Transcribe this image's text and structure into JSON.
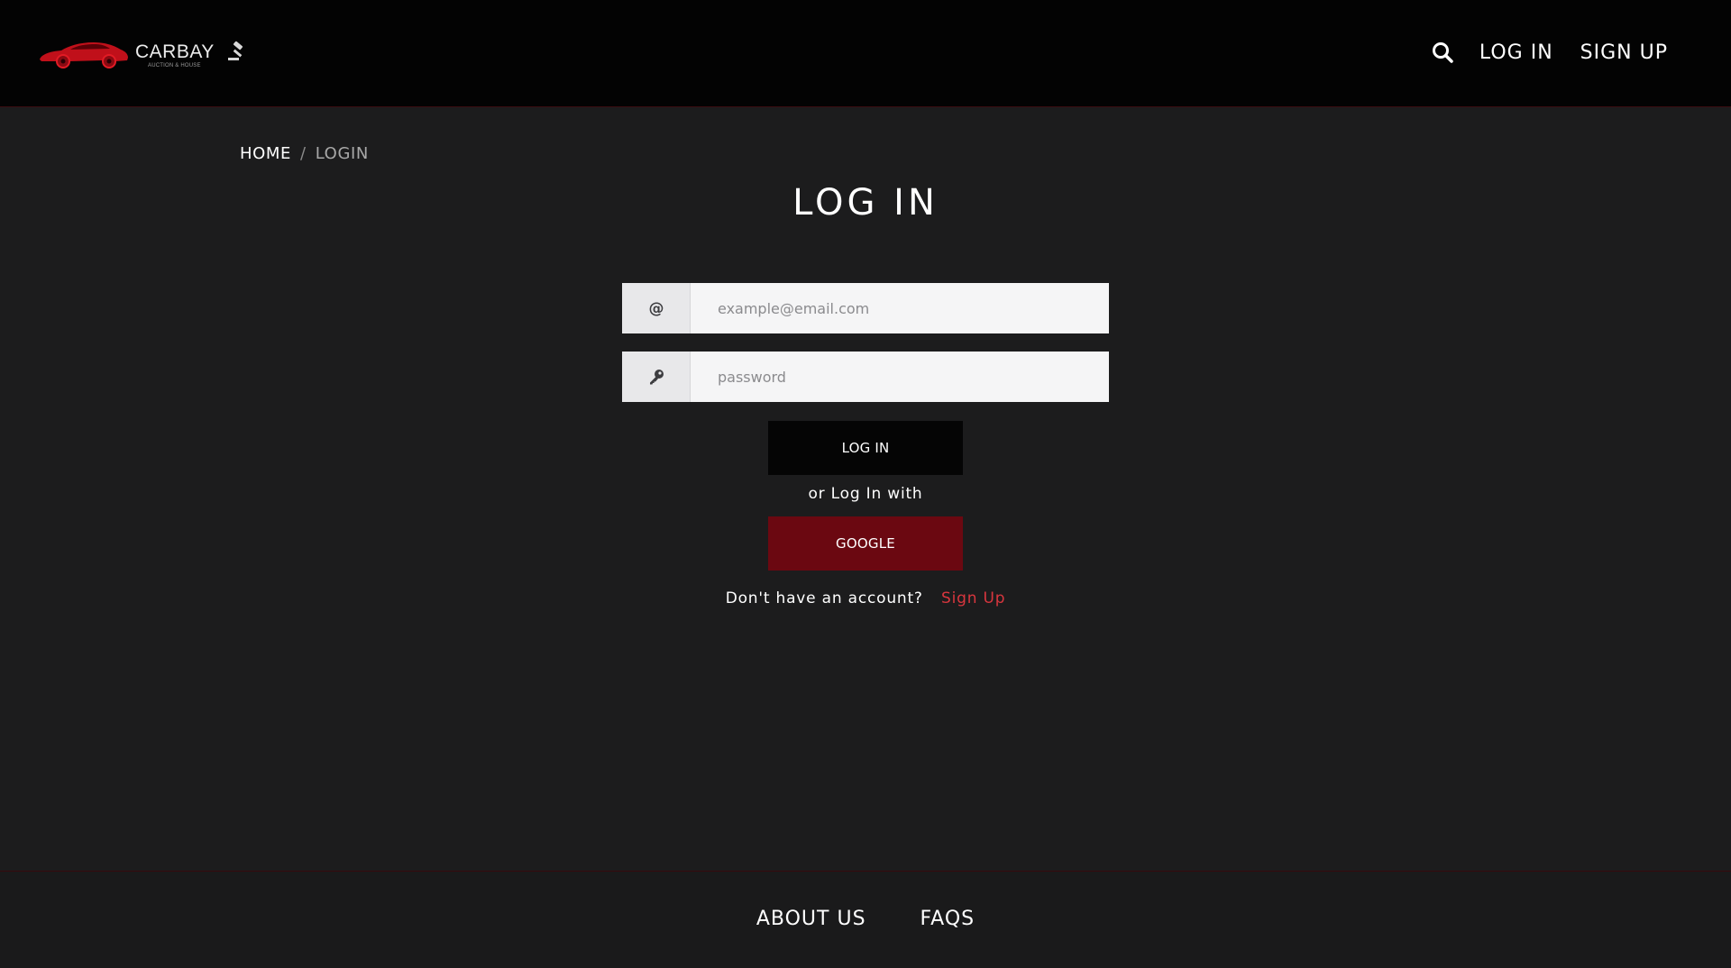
{
  "header": {
    "logo": {
      "brand": "CARBAY",
      "tagline": "AUCTION & HOUSE",
      "icon": "red-sports-car-logo"
    },
    "nav": {
      "search_icon": "search-icon",
      "login_label": "LOG IN",
      "signup_label": "SIGN UP"
    }
  },
  "breadcrumb": {
    "home": "HOME",
    "separator": "/",
    "current": "LOGIN"
  },
  "page": {
    "title": "LOG IN"
  },
  "form": {
    "email": {
      "icon": "at-sign-icon",
      "placeholder": "example@email.com",
      "value": ""
    },
    "password": {
      "icon": "key-icon",
      "placeholder": "password",
      "value": ""
    },
    "login_button": "LOG IN",
    "alt_text": "or Log In with",
    "google_button": "GOOGLE",
    "signup_prompt": "Don't have an account?",
    "signup_link": "Sign Up"
  },
  "footer": {
    "about": "ABOUT US",
    "faqs": "FAQS"
  },
  "colors": {
    "page_bg": "#1c1c1d",
    "header_bg": "#030303",
    "accent_red": "#6b0811",
    "link_red": "#d9363e",
    "logo_red": "#c0101a"
  }
}
